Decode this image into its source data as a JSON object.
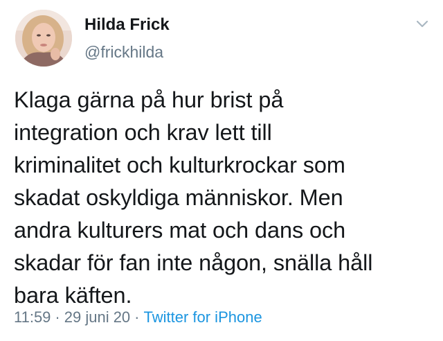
{
  "user": {
    "display_name": "Hilda Frick",
    "handle": "@frickhilda"
  },
  "tweet": {
    "text": "Klaga gärna på hur brist på\nintegration och krav lett till\nkriminalitet och kulturkrockar som\nskadat oskyldiga människor. Men\nandra kulturers mat och dans och\nskadar för fan inte någon, snälla håll\nbara käften.",
    "time": "11:59",
    "date": "29 juni 20",
    "separator": "·",
    "source": "Twitter for iPhone"
  },
  "icons": {
    "menu": "chevron-down-icon",
    "avatar": "profile-photo"
  },
  "colors": {
    "text": "#14171a",
    "secondary": "#657786",
    "link": "#1b95e0",
    "caret": "#aab8c2"
  }
}
